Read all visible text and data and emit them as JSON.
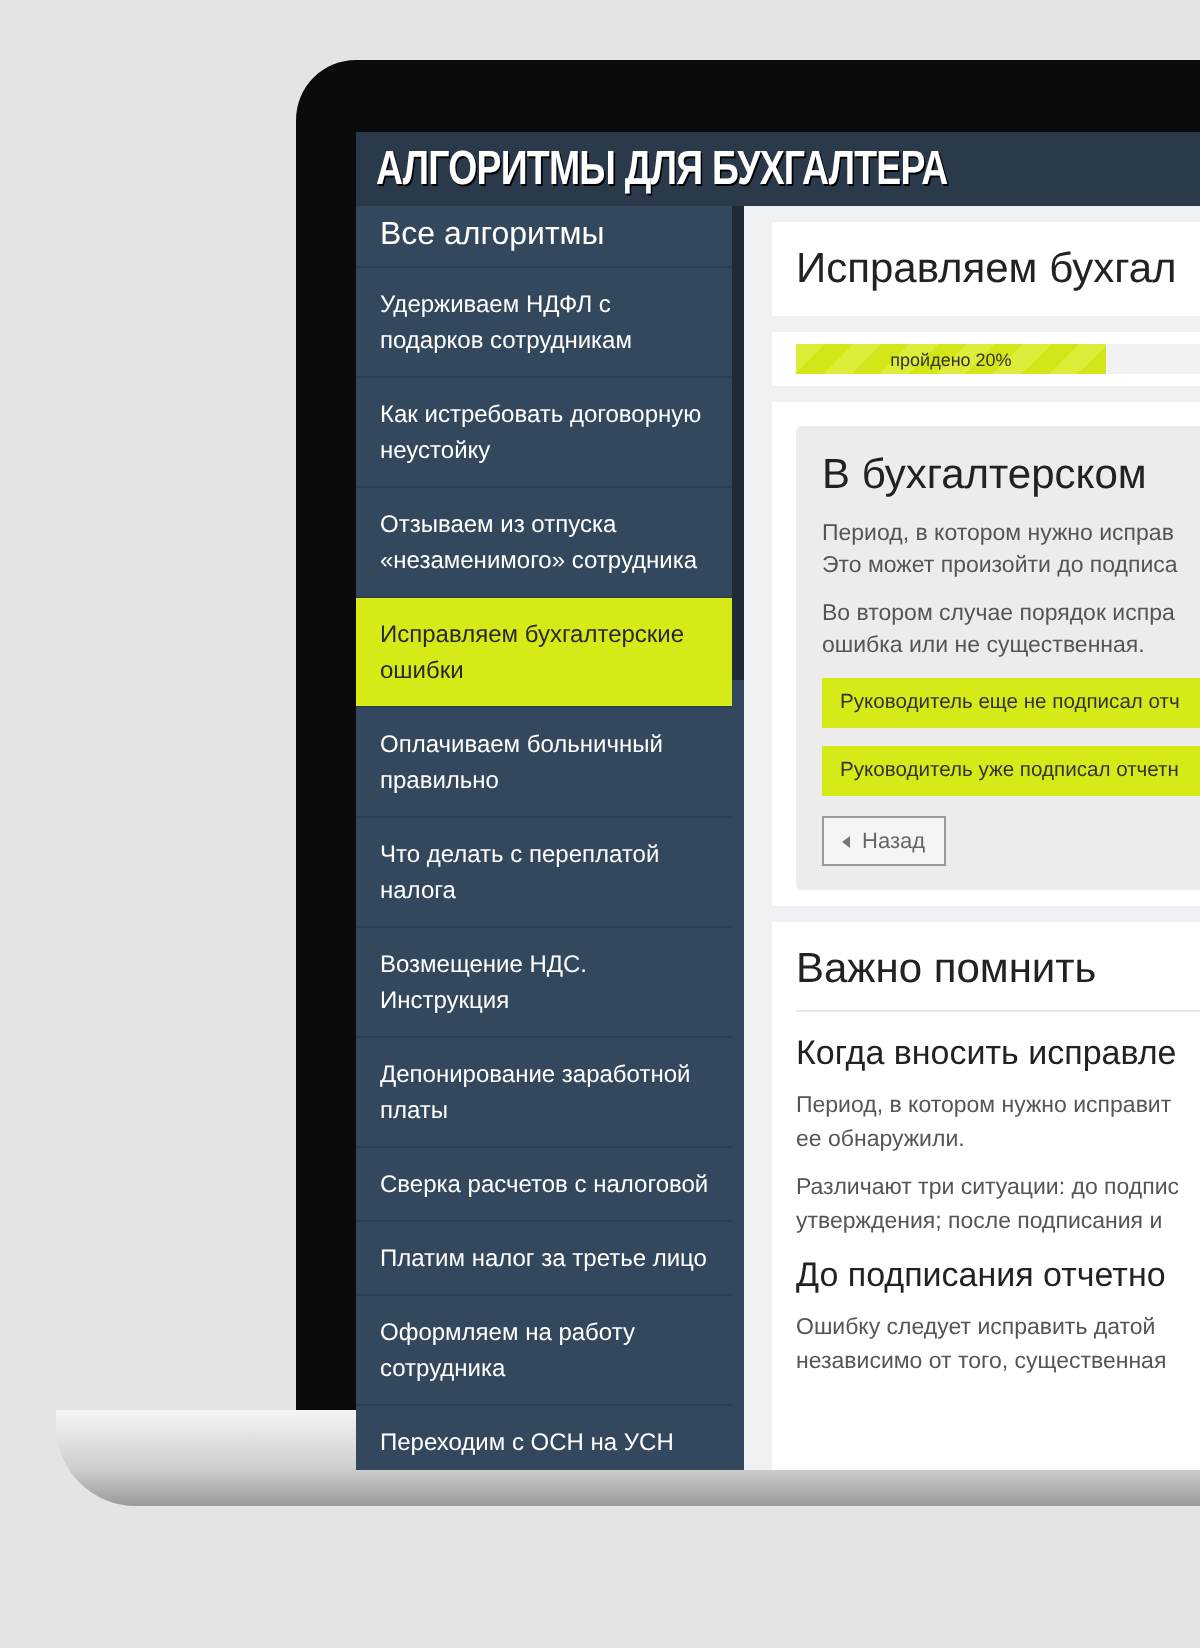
{
  "header": {
    "title": "АЛГОРИТМЫ ДЛЯ БУХГАЛТЕРА"
  },
  "sidebar": {
    "heading": "Все алгоритмы",
    "items": [
      {
        "label": "Удерживаем НДФЛ с подарков сотрудникам",
        "selected": false
      },
      {
        "label": "Как истребовать договорную неустойку",
        "selected": false
      },
      {
        "label": "Отзываем из отпуска «незаменимого» сотрудника",
        "selected": false
      },
      {
        "label": "Исправляем бухгалтерские ошибки",
        "selected": true
      },
      {
        "label": "Оплачиваем больничный правильно",
        "selected": false
      },
      {
        "label": "Что делать с переплатой налога",
        "selected": false
      },
      {
        "label": "Возмещение НДС. Инструкция",
        "selected": false
      },
      {
        "label": "Депонирование заработной платы",
        "selected": false
      },
      {
        "label": "Сверка расчетов с налоговой",
        "selected": false
      },
      {
        "label": "Платим налог за третье лицо",
        "selected": false
      },
      {
        "label": "Оформляем на работу сотрудника",
        "selected": false
      },
      {
        "label": "Переходим с ОСН на УСН",
        "selected": false
      }
    ]
  },
  "page_title": "Исправляем бухгал",
  "progress": {
    "label": "пройдено 20%",
    "level": 0.2
  },
  "step": {
    "title": "В бухгалтерском",
    "paragraphs": [
      [
        "Период, в котором нужно исправ",
        "Это может произойти до подписа"
      ],
      [
        "Во втором случае порядок испра",
        "ошибка или не существенная."
      ]
    ],
    "options": [
      "Руководитель еще не подписал отч",
      "Руководитель уже подписал отчетн"
    ],
    "back_button": "Назад"
  },
  "notes": {
    "title": "Важно помнить",
    "sections": [
      {
        "heading": "Когда вносить исправле",
        "paragraphs": [
          [
            "Период, в котором нужно исправит",
            "ее обнаружили."
          ],
          [
            "Различают три ситуации: до подпис",
            "утверждения; после подписания и"
          ]
        ]
      },
      {
        "heading": "До подписания отчетно",
        "paragraphs": [
          [
            "Ошибку следует исправить датой",
            "независимо от того, существенная"
          ]
        ]
      }
    ]
  }
}
